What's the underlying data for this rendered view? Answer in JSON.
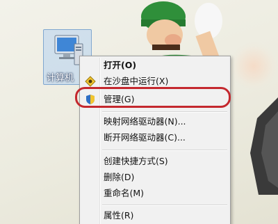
{
  "desktop": {
    "icon_label": "计算机",
    "icon_name": "computer-icon"
  },
  "context_menu": {
    "items": [
      {
        "label": "打开(O)",
        "bold": true
      },
      {
        "label": "在沙盘中运行(X)",
        "icon": "sandbox-icon"
      },
      {
        "label": "管理(G)",
        "icon": "shield-icon"
      },
      {
        "label": "映射网络驱动器(N)..."
      },
      {
        "label": "断开网络驱动器(C)..."
      },
      {
        "label": "创建快捷方式(S)"
      },
      {
        "label": "删除(D)"
      },
      {
        "label": "重命名(M)"
      },
      {
        "label": "属性(R)"
      }
    ],
    "highlighted_item": "管理(G)"
  },
  "colors": {
    "highlight_ring": "#c4282e",
    "menu_bg": "#f1f1f1"
  }
}
